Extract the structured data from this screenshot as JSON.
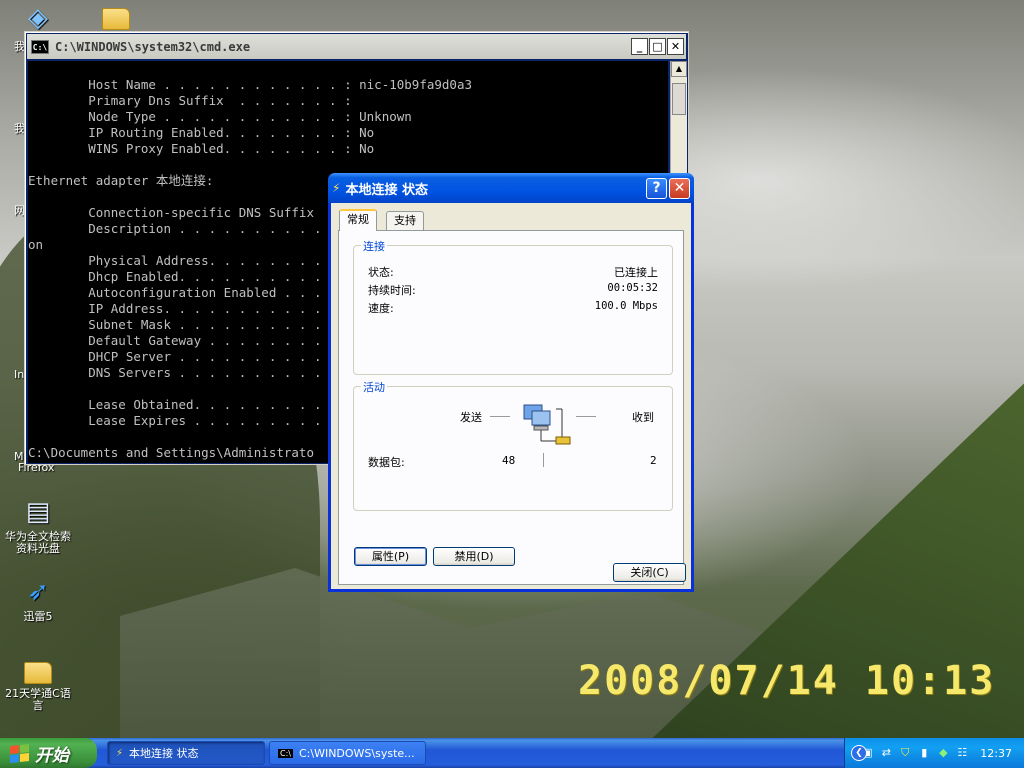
{
  "desktop": {
    "timestamp": "2008/07/14 10:13",
    "icons": [
      {
        "label": "华为全文检索资料光盘"
      },
      {
        "label": "迅雷5"
      },
      {
        "label": "21天学通C语言"
      }
    ],
    "partial_label_firefox": "Firefox"
  },
  "cmd": {
    "title": "C:\\WINDOWS\\system32\\cmd.exe",
    "lines": [
      "        Host Name . . . . . . . . . . . . : nic-10b9fa9d0a3",
      "        Primary Dns Suffix  . . . . . . . :",
      "        Node Type . . . . . . . . . . . . : Unknown",
      "        IP Routing Enabled. . . . . . . . : No",
      "        WINS Proxy Enabled. . . . . . . . : No",
      "",
      "Ethernet adapter 本地连接:",
      "",
      "        Connection-specific DNS Suffix",
      "        Description . . . . . . . . . .",
      "on",
      "        Physical Address. . . . . . . .",
      "        Dhcp Enabled. . . . . . . . . .",
      "        Autoconfiguration Enabled . . .",
      "        IP Address. . . . . . . . . . .",
      "        Subnet Mask . . . . . . . . . .",
      "        Default Gateway . . . . . . . .",
      "        DHCP Server . . . . . . . . . .",
      "        DNS Servers . . . . . . . . . .",
      "",
      "        Lease Obtained. . . . . . . . .",
      "        Lease Expires . . . . . . . . .",
      "",
      "C:\\Documents and Settings\\Administrato"
    ]
  },
  "dialog": {
    "title": "本地连接 状态",
    "help_label": "?",
    "tabs": [
      {
        "label": "常规"
      },
      {
        "label": "支持"
      }
    ],
    "connection": {
      "group_label": "连接",
      "status_label": "状态:",
      "status_value": "已连接上",
      "duration_label": "持续时间:",
      "duration_value": "00:05:32",
      "speed_label": "速度:",
      "speed_value": "100.0 Mbps"
    },
    "activity": {
      "group_label": "活动",
      "sent_label": "发送",
      "received_label": "收到",
      "packets_label": "数据包:",
      "packets_sent": "48",
      "packets_received": "2"
    },
    "buttons": {
      "properties": "属性(P)",
      "disable": "禁用(D)",
      "close": "关闭(C)"
    }
  },
  "taskbar": {
    "start_label": "开始",
    "tasks": [
      {
        "label": "本地连接 状态"
      },
      {
        "label": "C:\\WINDOWS\\syste..."
      }
    ],
    "clock": "12:37"
  }
}
